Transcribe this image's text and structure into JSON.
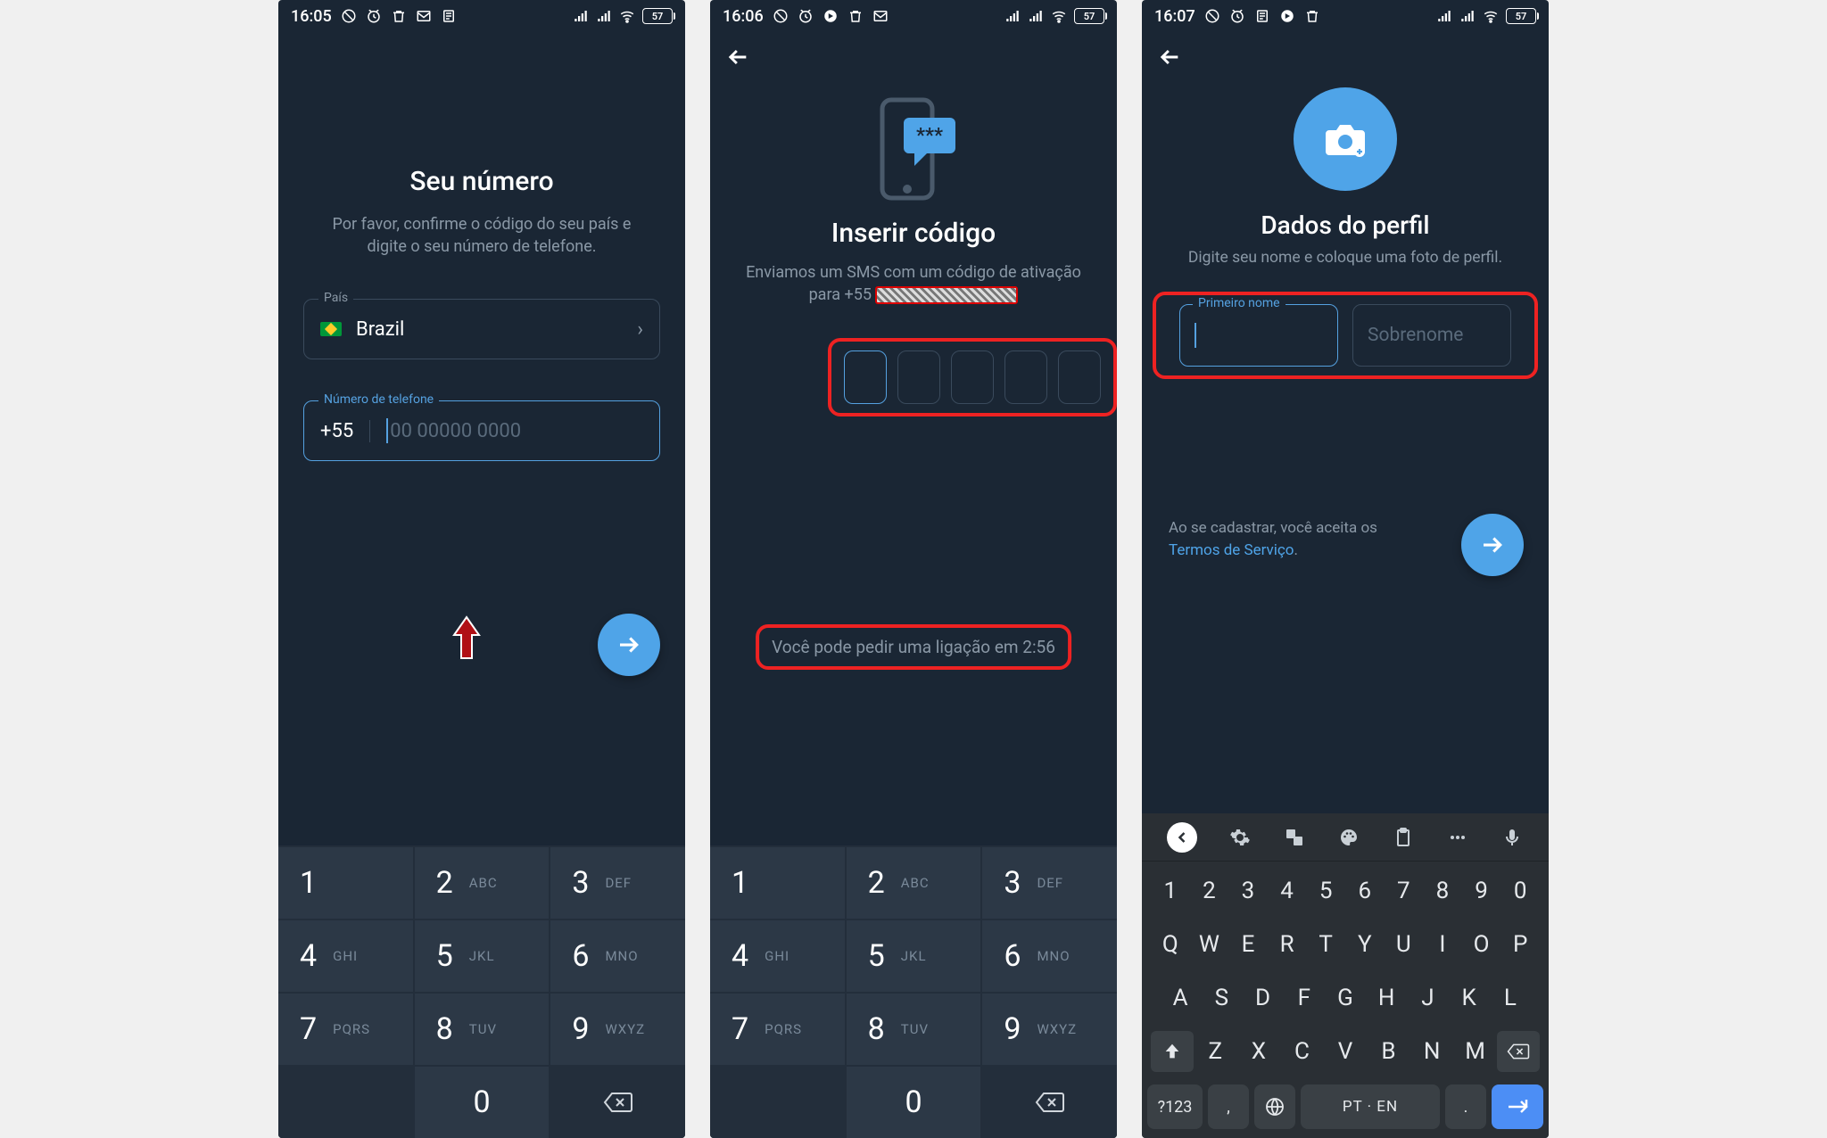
{
  "statusbar": {
    "s1": {
      "time": "16:05",
      "battery": "57"
    },
    "s2": {
      "time": "16:06",
      "battery": "57"
    },
    "s3": {
      "time": "16:07",
      "battery": "57"
    }
  },
  "screen1": {
    "title": "Seu número",
    "subtitle": "Por favor, confirme o código do seu país e digite o seu número de telefone.",
    "country_label": "País",
    "country_name": "Brazil",
    "phone_label": "Número de telefone",
    "prefix": "+55",
    "placeholder": "00 00000 0000"
  },
  "screen2": {
    "title": "Inserir código",
    "subtitle_pre": "Enviamos um SMS com um código de ativação para ",
    "subtitle_num": "+55",
    "call_text": "Você pode pedir uma ligação em 2:56"
  },
  "screen3": {
    "title": "Dados do perfil",
    "subtitle": "Digite seu nome e coloque uma foto de perfil.",
    "first_label": "Primeiro nome",
    "last_placeholder": "Sobrenome",
    "terms_pre": "Ao se cadastrar, você aceita os ",
    "terms_link": "Termos de Serviço",
    "terms_post": "."
  },
  "numpad": [
    {
      "d": "1",
      "l": ""
    },
    {
      "d": "2",
      "l": "ABC"
    },
    {
      "d": "3",
      "l": "DEF"
    },
    {
      "d": "4",
      "l": "GHI"
    },
    {
      "d": "5",
      "l": "JKL"
    },
    {
      "d": "6",
      "l": "MNO"
    },
    {
      "d": "7",
      "l": "PQRS"
    },
    {
      "d": "8",
      "l": "TUV"
    },
    {
      "d": "9",
      "l": "WXYZ"
    }
  ],
  "numpad_zero": "0",
  "gboard": {
    "nums": [
      "1",
      "2",
      "3",
      "4",
      "5",
      "6",
      "7",
      "8",
      "9",
      "0"
    ],
    "row1": [
      "Q",
      "W",
      "E",
      "R",
      "T",
      "Y",
      "U",
      "I",
      "O",
      "P"
    ],
    "row2": [
      "A",
      "S",
      "D",
      "F",
      "G",
      "H",
      "J",
      "K",
      "L"
    ],
    "row3": [
      "Z",
      "X",
      "C",
      "V",
      "B",
      "N",
      "M"
    ],
    "sym": "?123",
    "comma": ",",
    "space": "PT · EN",
    "period": "."
  }
}
